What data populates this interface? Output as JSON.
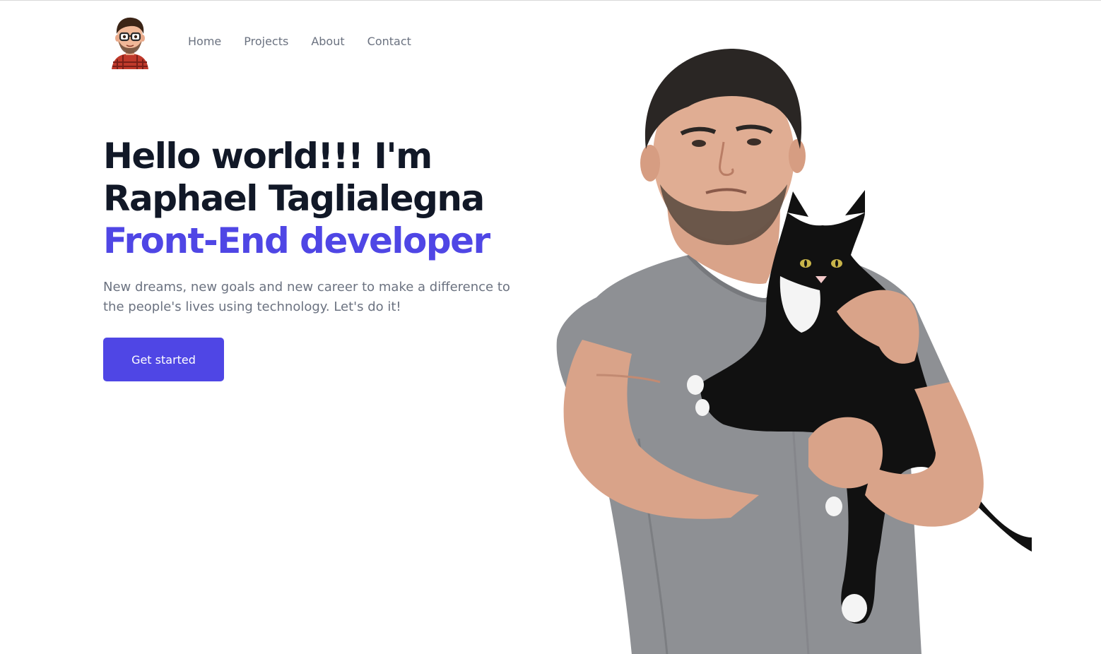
{
  "nav": {
    "logo_alt": "avatar",
    "links": [
      {
        "label": "Home"
      },
      {
        "label": "Projects"
      },
      {
        "label": "About"
      },
      {
        "label": "Contact"
      }
    ]
  },
  "hero": {
    "title_line1": "Hello world!!! I'm",
    "title_line2": "Raphael Taglialegna",
    "title_accent": "Front-End developer",
    "description": "New dreams, new goals and new career to make a difference to the people's lives using technology. Let's do it!",
    "cta_label": "Get started",
    "photo_alt": "man-holding-cat-photo"
  },
  "colors": {
    "accent": "#4f46e5",
    "heading": "#111827",
    "muted": "#6b7280"
  }
}
